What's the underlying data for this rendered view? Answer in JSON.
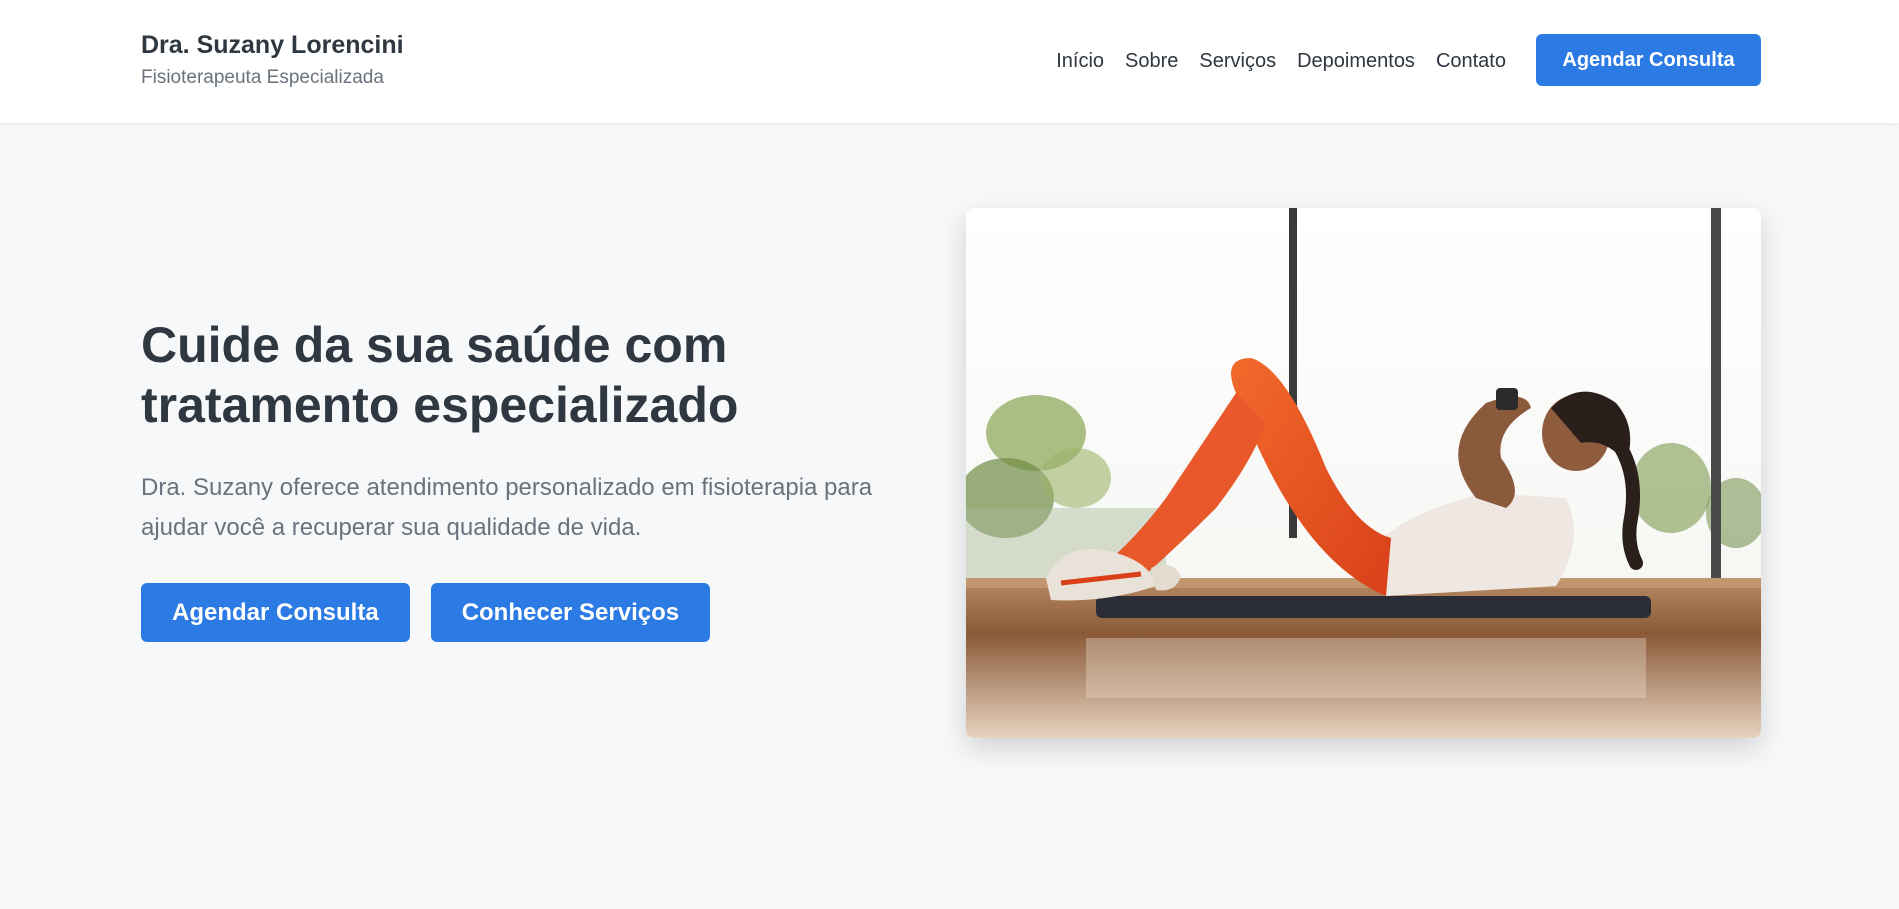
{
  "header": {
    "brand_name": "Dra. Suzany Lorencini",
    "brand_subtitle": "Fisioterapeuta Especializada",
    "nav": [
      "Início",
      "Sobre",
      "Serviços",
      "Depoimentos",
      "Contato"
    ],
    "cta_label": "Agendar Consulta"
  },
  "hero": {
    "title": "Cuide da sua saúde com tratamento especializado",
    "description": "Dra. Suzany oferece atendimento personalizado em fisioterapia para ajudar você a recuperar sua qualidade de vida.",
    "primary_button": "Agendar Consulta",
    "secondary_button": "Conhecer Serviços",
    "image_subject": "woman doing crunches on an exercise mat"
  },
  "colors": {
    "accent": "#2c7be5",
    "text": "#2f3740",
    "muted": "#6a737d",
    "background": "#f6f8fa"
  }
}
